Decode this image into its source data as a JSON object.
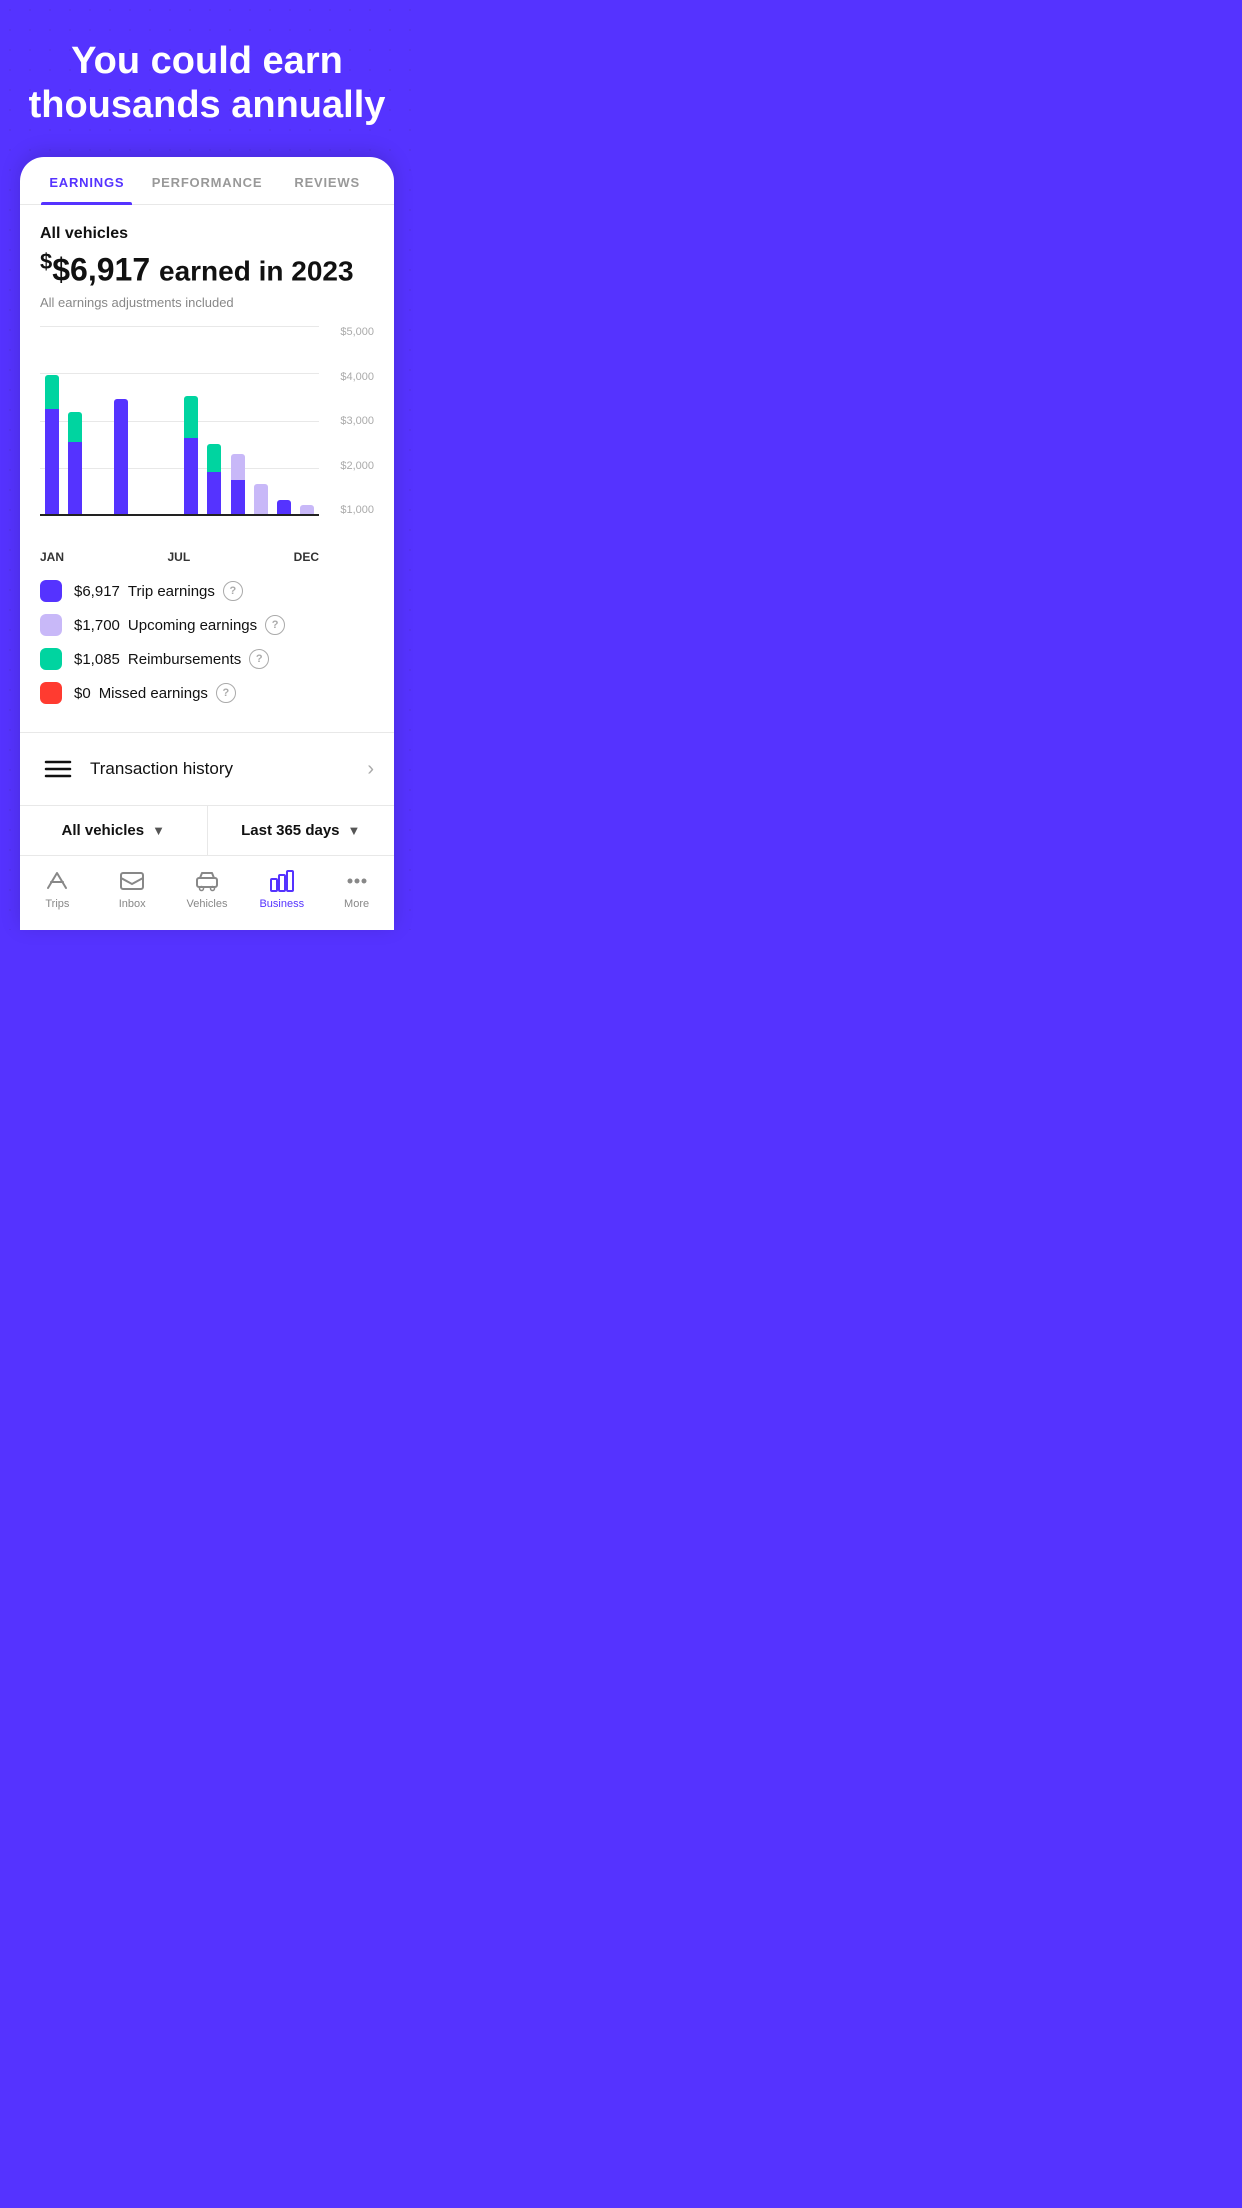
{
  "hero": {
    "line1": "You could earn",
    "line2": "thousands annually"
  },
  "tabs": [
    {
      "id": "earnings",
      "label": "EARNINGS",
      "active": true
    },
    {
      "id": "performance",
      "label": "PERFORMANCE",
      "active": false
    },
    {
      "id": "reviews",
      "label": "REVIEWS",
      "active": false
    }
  ],
  "earnings": {
    "vehicle_label": "All vehicles",
    "amount": "$6,917",
    "year": "2023",
    "heading": "earned in 2023",
    "note": "All earnings adjustments included",
    "chart": {
      "y_labels": [
        "$5,000",
        "$4,000",
        "$3,000",
        "$2,000",
        "$1,000"
      ],
      "x_labels": [
        "JAN",
        "JUL",
        "DEC"
      ],
      "bars": [
        {
          "month": "Jan",
          "blue": 55,
          "green": 18,
          "lavender": 0
        },
        {
          "month": "Feb",
          "blue": 38,
          "green": 16,
          "lavender": 0
        },
        {
          "month": "Mar",
          "blue": 0,
          "green": 0,
          "lavender": 0
        },
        {
          "month": "Apr",
          "blue": 60,
          "green": 0,
          "lavender": 0
        },
        {
          "month": "May",
          "blue": 0,
          "green": 0,
          "lavender": 0
        },
        {
          "month": "Jun",
          "blue": 0,
          "green": 0,
          "lavender": 0
        },
        {
          "month": "Jul",
          "blue": 40,
          "green": 22,
          "lavender": 0
        },
        {
          "month": "Aug",
          "blue": 22,
          "green": 15,
          "lavender": 0
        },
        {
          "month": "Sep",
          "blue": 18,
          "green": 0,
          "lavender": 14
        },
        {
          "month": "Oct",
          "blue": 0,
          "green": 0,
          "lavender": 16
        },
        {
          "month": "Nov",
          "blue": 8,
          "green": 0,
          "lavender": 0
        },
        {
          "month": "Dec",
          "blue": 0,
          "green": 0,
          "lavender": 5
        }
      ]
    },
    "legend": [
      {
        "color": "blue",
        "amount": "$6,917",
        "label": "Trip earnings"
      },
      {
        "color": "lavender",
        "amount": "$1,700",
        "label": "Upcoming earnings"
      },
      {
        "color": "green",
        "amount": "$1,085",
        "label": "Reimbursements"
      },
      {
        "color": "red",
        "amount": "$0",
        "label": "Missed earnings"
      }
    ]
  },
  "transaction_history": {
    "label": "Transaction history"
  },
  "filters": {
    "vehicle_filter": "All vehicles",
    "date_filter": "Last 365 days"
  },
  "nav": {
    "items": [
      {
        "id": "trips",
        "label": "Trips",
        "active": false
      },
      {
        "id": "inbox",
        "label": "Inbox",
        "active": false
      },
      {
        "id": "vehicles",
        "label": "Vehicles",
        "active": false
      },
      {
        "id": "business",
        "label": "Business",
        "active": true
      },
      {
        "id": "more",
        "label": "More",
        "active": false
      }
    ]
  }
}
